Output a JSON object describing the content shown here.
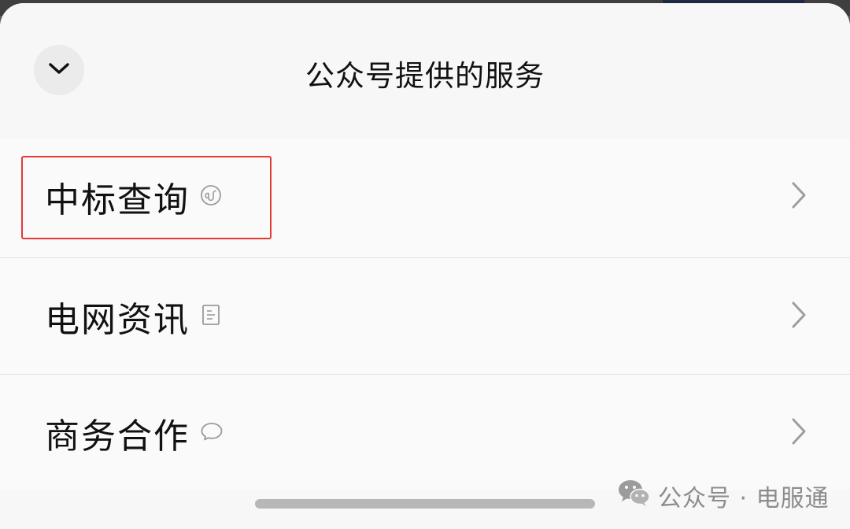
{
  "sheet": {
    "title": "公众号提供的服务",
    "collapse_icon": "chevron-down-icon"
  },
  "services": [
    {
      "label": "中标查询",
      "icon": "mini-program-icon",
      "highlighted": true
    },
    {
      "label": "电网资讯",
      "icon": "article-icon",
      "highlighted": false
    },
    {
      "label": "商务合作",
      "icon": "chat-bubble-icon",
      "highlighted": false
    }
  ],
  "row_arrow_icon": "chevron-right-icon",
  "watermark": {
    "icon": "wechat-icon",
    "text": "公众号 · 电服通"
  },
  "colors": {
    "highlight_border": "#e53935",
    "sheet_background": "#f7f7f7"
  }
}
